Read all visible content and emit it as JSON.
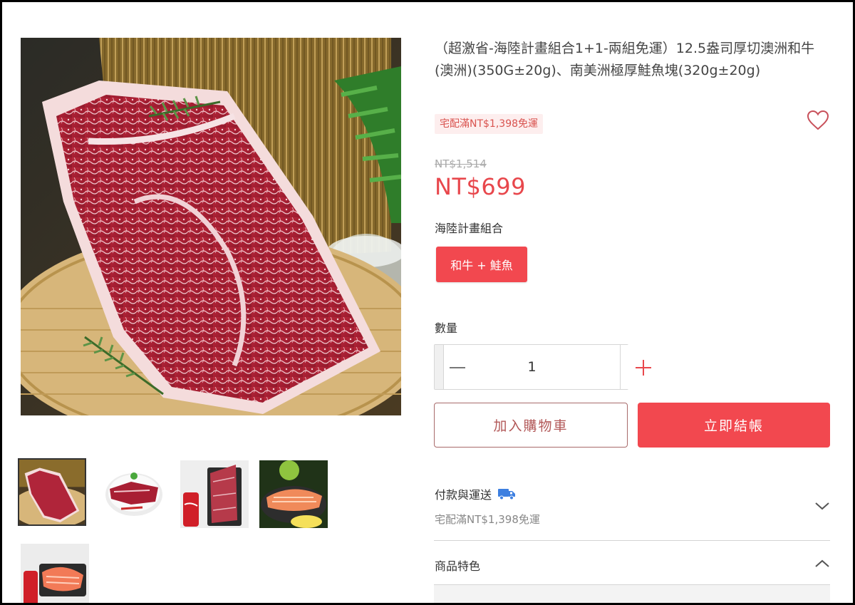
{
  "product": {
    "title": "（超激省-海陸計畫組合1+1-兩組免運）12.5盎司厚切澳洲和牛(澳洲)(350G±20g)、南美洲極厚鮭魚塊(320g±20g)",
    "shipping_badge": "宅配滿NT$1,398免運",
    "original_price": "NT$1,514",
    "price": "NT$699",
    "favorite_icon": "heart-outline-icon"
  },
  "variants": {
    "label": "海陸計畫組合",
    "options": [
      {
        "label": "和牛 + 鮭魚",
        "selected": true
      }
    ]
  },
  "quantity": {
    "label": "數量",
    "value": "1",
    "decrement_icon": "minus-icon",
    "increment_icon": "plus-icon"
  },
  "actions": {
    "add_to_cart": "加入購物車",
    "checkout": "立即結帳"
  },
  "accordion": {
    "payment": {
      "title": "付款與運送",
      "icon": "delivery-truck-icon",
      "subtitle": "宅配滿NT$1,398免運",
      "expanded": false
    },
    "features": {
      "title": "商品特色",
      "expanded": true
    }
  },
  "gallery": {
    "main": "wagyu-steak-on-bamboo-tray",
    "thumbnails": [
      {
        "name": "wagyu-steak-on-bamboo-tray",
        "active": true
      },
      {
        "name": "wagyu-steak-on-plate",
        "active": false
      },
      {
        "name": "wagyu-steak-package-with-cola-can",
        "active": false
      },
      {
        "name": "salmon-steak-with-lemon",
        "active": false
      },
      {
        "name": "salmon-package-with-cola-can",
        "active": false
      }
    ]
  },
  "colors": {
    "accent": "#f2484f",
    "price": "#e8474c",
    "badge_bg": "#fdeeee"
  }
}
